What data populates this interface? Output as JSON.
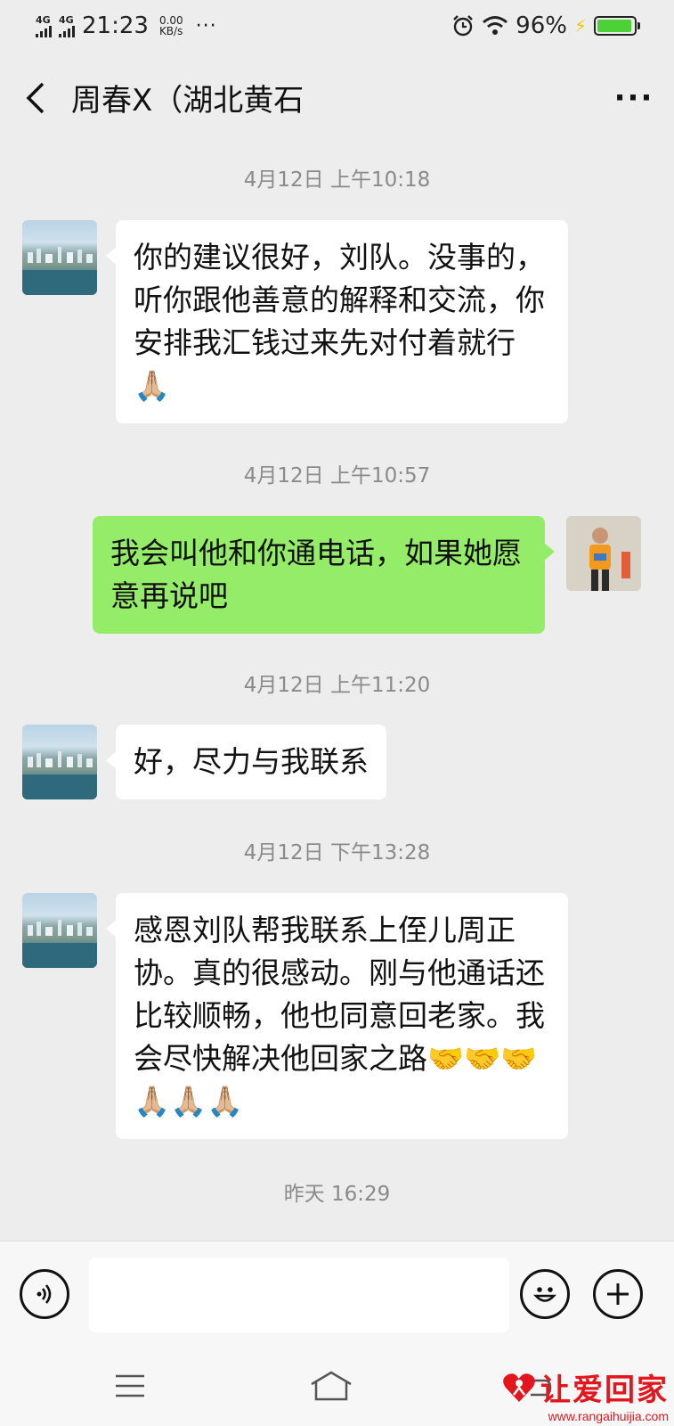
{
  "status_bar": {
    "network1": "4G",
    "network2": "4G",
    "time": "21:23",
    "speed_value": "0.00",
    "speed_unit": "KB/s",
    "more": "···",
    "battery": "96%",
    "battery_level": 0.96
  },
  "header": {
    "title": "周春X（湖北黄石",
    "more": "···"
  },
  "messages": [
    {
      "type": "time",
      "text": "4月12日 上午10:18"
    },
    {
      "type": "in",
      "text": "你的建议很好，刘队。没事的，听你跟他善意的解释和交流，你安排我汇钱过来先对付着就行🙏🏼"
    },
    {
      "type": "time",
      "text": "4月12日 上午10:57"
    },
    {
      "type": "out",
      "text": "我会叫他和你通电话，如果她愿意再说吧"
    },
    {
      "type": "time",
      "text": "4月12日 上午11:20"
    },
    {
      "type": "in",
      "text": "好，尽力与我联系"
    },
    {
      "type": "time",
      "text": "4月12日 下午13:28"
    },
    {
      "type": "in",
      "text": "感恩刘队帮我联系上侄儿周正协。真的很感动。刚与他通话还比较顺畅，他也同意回老家。我会尽快解决他回家之路🤝🤝🤝🙏🏼🙏🏼🙏🏼"
    },
    {
      "type": "time",
      "text": "昨天 16:29"
    }
  ],
  "input": {
    "placeholder": ""
  },
  "icons": {
    "voice": "voice-icon",
    "emoji": "emoji-icon",
    "add": "plus-icon",
    "back": "back-arrow-icon",
    "menu": "menu-icon",
    "home": "home-icon",
    "return": "return-icon"
  },
  "watermark": {
    "title": "让爱回家",
    "url": "www.rangaihuijia.com"
  },
  "colors": {
    "background": "#ededed",
    "incoming_bubble": "#ffffff",
    "outgoing_bubble": "#95ec69",
    "watermark": "#e3161d"
  }
}
